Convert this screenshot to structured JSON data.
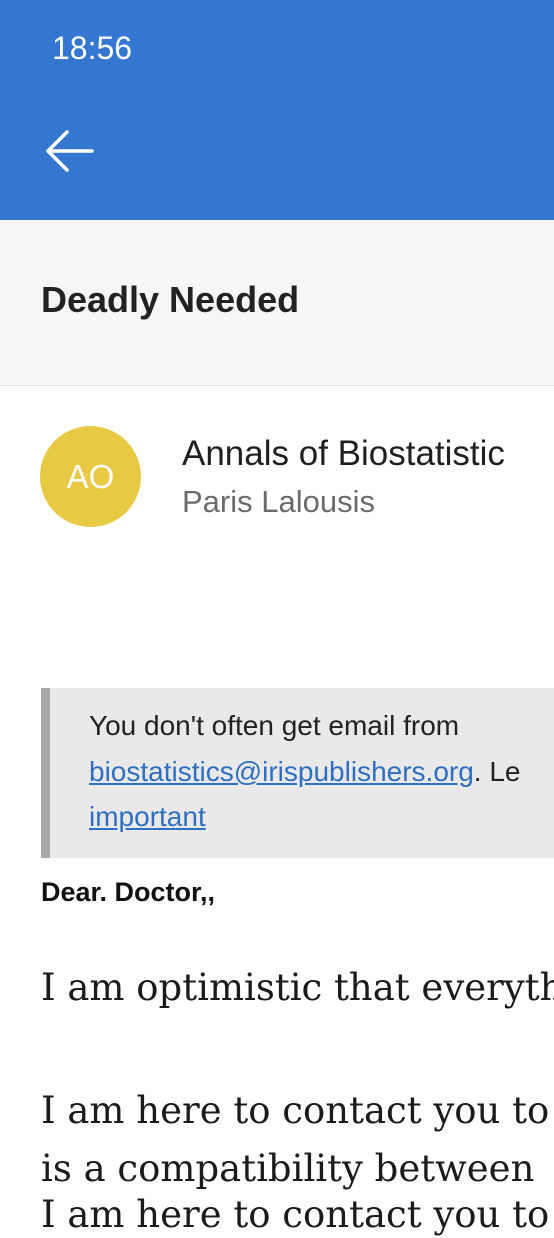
{
  "status_bar": {
    "time": "18:56"
  },
  "toolbar": {
    "back_icon": "arrow-left-icon"
  },
  "header": {
    "subject": "Deadly Needed"
  },
  "sender": {
    "initials": "AO",
    "avatar_color": "#e8c944",
    "name": "Annals of Biostatistic",
    "sub": "Paris Lalousis"
  },
  "notice": {
    "line1": "You don't often get email from",
    "email_link": "biostatistics@irispublishers.org",
    "after_link": ". Le",
    "line3_link": "important"
  },
  "message": {
    "greeting": "Dear. Doctor,,",
    "line1": "I am optimistic that everyth",
    "line2": "I am here to contact you to",
    "line3": "is a compatibility between",
    "line4": "I am here to contact you to"
  },
  "colors": {
    "accent": "#3476d0",
    "link": "#2f6fc0",
    "notice_bg": "#e9e9e9"
  }
}
